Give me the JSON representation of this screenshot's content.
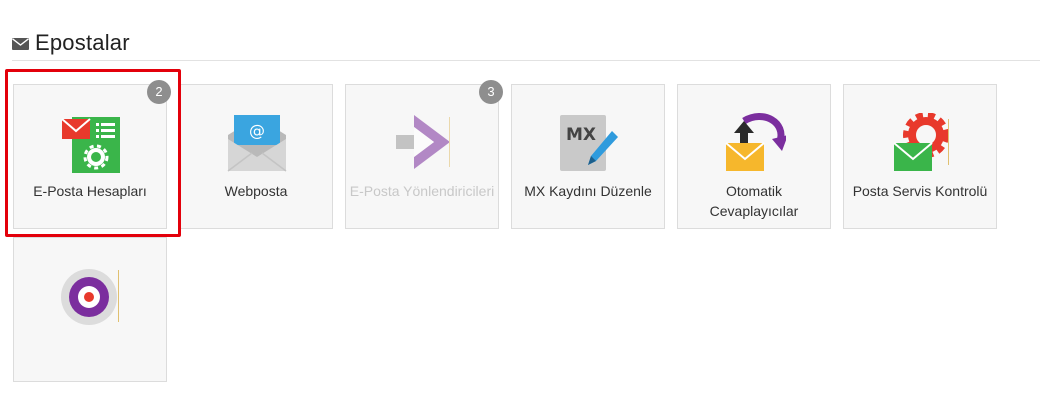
{
  "section": {
    "title": "Epostalar",
    "icon": "envelope-icon"
  },
  "tiles": [
    {
      "label": "E-Posta Hesapları",
      "badge": "2",
      "icon": "email-accounts-icon"
    },
    {
      "label": "Webposta",
      "icon": "webmail-icon"
    },
    {
      "label": "E-Posta Yönlendiricileri",
      "badge": "3",
      "icon": "email-forwarder-icon",
      "disabled": true
    },
    {
      "label": "MX Kaydını Düzenle",
      "icon": "mx-record-icon"
    },
    {
      "label": "Otomatik Cevaplayıcılar",
      "icon": "autoresponder-icon"
    },
    {
      "label": "Posta Servis Kontrolü",
      "icon": "mail-service-control-icon"
    },
    {
      "label": "",
      "icon": "spam-filter-icon"
    }
  ],
  "colors": {
    "highlight": "#e3000b",
    "badge": "#8e8e8e",
    "tile_bg": "#f7f7f7"
  }
}
